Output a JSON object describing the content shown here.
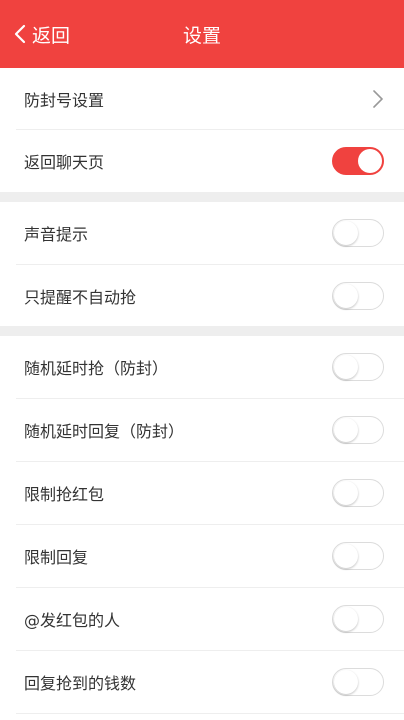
{
  "header": {
    "back_label": "返回",
    "title": "设置",
    "background": "#f0423f"
  },
  "settings": {
    "anti_block": {
      "label": "防封号设置",
      "icon": "chevron-right-icon"
    },
    "return_chat": {
      "label": "返回聊天页",
      "on": true
    },
    "sound_prompt": {
      "label": "声音提示",
      "on": false
    },
    "remind_only": {
      "label": "只提醒不自动抢",
      "on": false
    },
    "random_delay_grab": {
      "label": "随机延时抢（防封）",
      "on": false
    },
    "random_delay_reply": {
      "label": "随机延时回复（防封）",
      "on": false
    },
    "limit_grab": {
      "label": "限制抢红包",
      "on": false
    },
    "limit_reply": {
      "label": "限制回复",
      "on": false
    },
    "at_sender": {
      "label": "@发红包的人",
      "on": false
    },
    "reply_amount": {
      "label": "回复抢到的钱数",
      "on": false
    }
  },
  "colors": {
    "accent": "#f0423f",
    "divider": "#eeeeee",
    "text": "#333333"
  }
}
